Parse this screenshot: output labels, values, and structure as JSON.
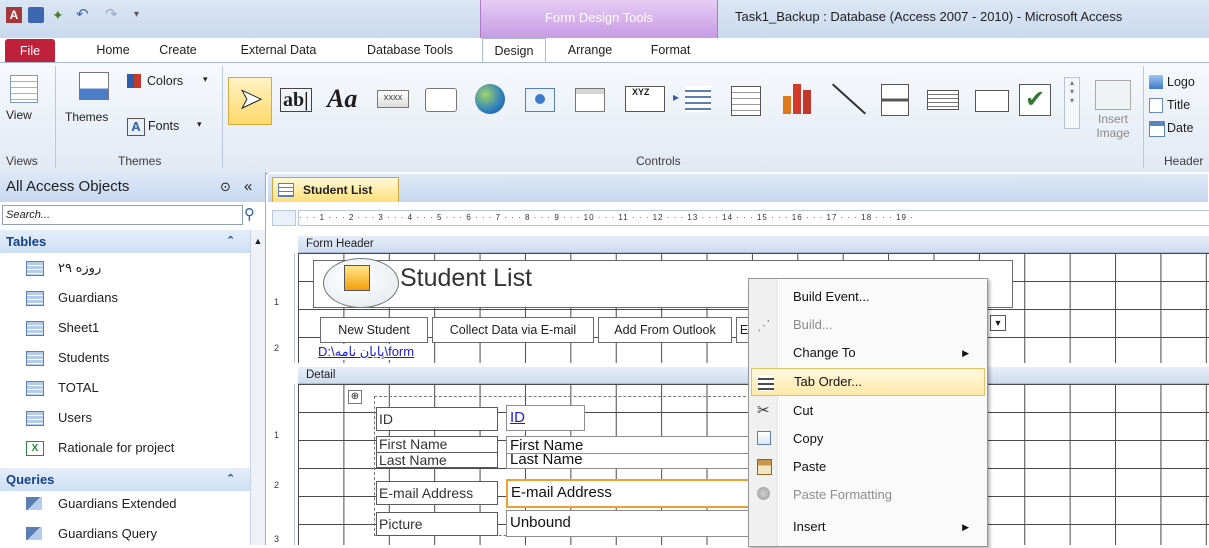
{
  "title_bar": {
    "context_group": "Form Design Tools",
    "window_title": "Task1_Backup : Database (Access 2007 - 2010)  -  Microsoft Access"
  },
  "tabs": [
    "File",
    "Home",
    "Create",
    "External Data",
    "Database Tools",
    "Design",
    "Arrange",
    "Format"
  ],
  "ribbon": {
    "views": {
      "view_label": "View",
      "group": "Views"
    },
    "themes": {
      "themes_label": "Themes",
      "colors_label": "Colors",
      "fonts_label": "Fonts",
      "group": "Themes"
    },
    "controls": {
      "label_text": "Aa",
      "textbox_text": "ab|",
      "xyz_text": "XYZ",
      "xxxx_text": "XXXX",
      "insert_image": "Insert Image",
      "group": "Controls"
    },
    "header_footer": {
      "logo": "Logo",
      "title": "Title",
      "date": "Date",
      "group": "Header"
    }
  },
  "nav": {
    "header": "All Access Objects",
    "search_placeholder": "Search...",
    "tables_group": "Tables",
    "tables": [
      "۲۹ روزه",
      "Guardians",
      "Sheet1",
      "Students",
      "TOTAL",
      "Users",
      "Rationale for project"
    ],
    "queries_group": "Queries",
    "queries": [
      "Guardians Extended",
      "Guardians Query"
    ]
  },
  "document": {
    "tab_label": "Student List",
    "ruler": "· · · 1 · · · 2 · · · 3 · · · 4 · · · 5 · · · 6 · · · 7 · · · 8 · · · 9 · · · 10 · · · 11 · · · 12 · · · 13 · · · 14 · · · 15 · · · 16 · · · 17 · · · 18 · · · 19 ·",
    "form_header_label": "Form Header",
    "form_title": "Student List",
    "header_buttons": [
      "New Student",
      "Collect Data via E-mail",
      "Add From Outlook",
      "E"
    ],
    "link_text": "D:\\پایان نامه\\form",
    "detail_label": "Detail",
    "fields": [
      {
        "label": "ID",
        "value": "ID"
      },
      {
        "label": "First Name",
        "value": "First Name"
      },
      {
        "label": "Last Name",
        "value": "Last Name"
      },
      {
        "label": "E-mail Address",
        "value": "E-mail Address"
      },
      {
        "label": "Picture",
        "value": "Unbound"
      }
    ],
    "vruler_header": [
      "1",
      "2"
    ],
    "vruler_detail": [
      "1",
      "2",
      "3"
    ]
  },
  "context_menu": {
    "items": [
      "Build Event...",
      "Build...",
      "Change To",
      "Tab Order...",
      "Cut",
      "Copy",
      "Paste",
      "Paste Formatting",
      "Insert"
    ]
  }
}
